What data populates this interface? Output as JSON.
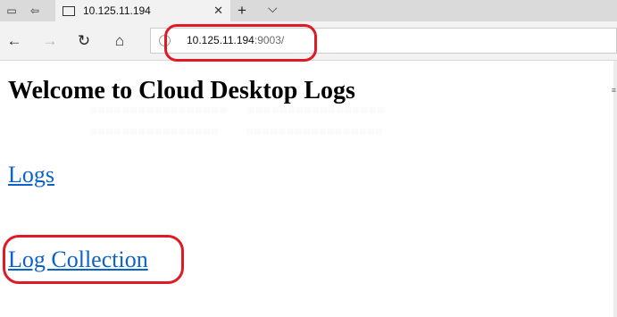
{
  "tab": {
    "title": "10.125.11.194"
  },
  "address_bar": {
    "host": "10.125.11.194",
    "port_path": ":9003/"
  },
  "page": {
    "heading": "Welcome to Cloud Desktop Logs",
    "links": [
      "Logs",
      "Log Collection"
    ]
  },
  "colors": {
    "link": "#0b62c9",
    "annotation": "#e01a24"
  }
}
